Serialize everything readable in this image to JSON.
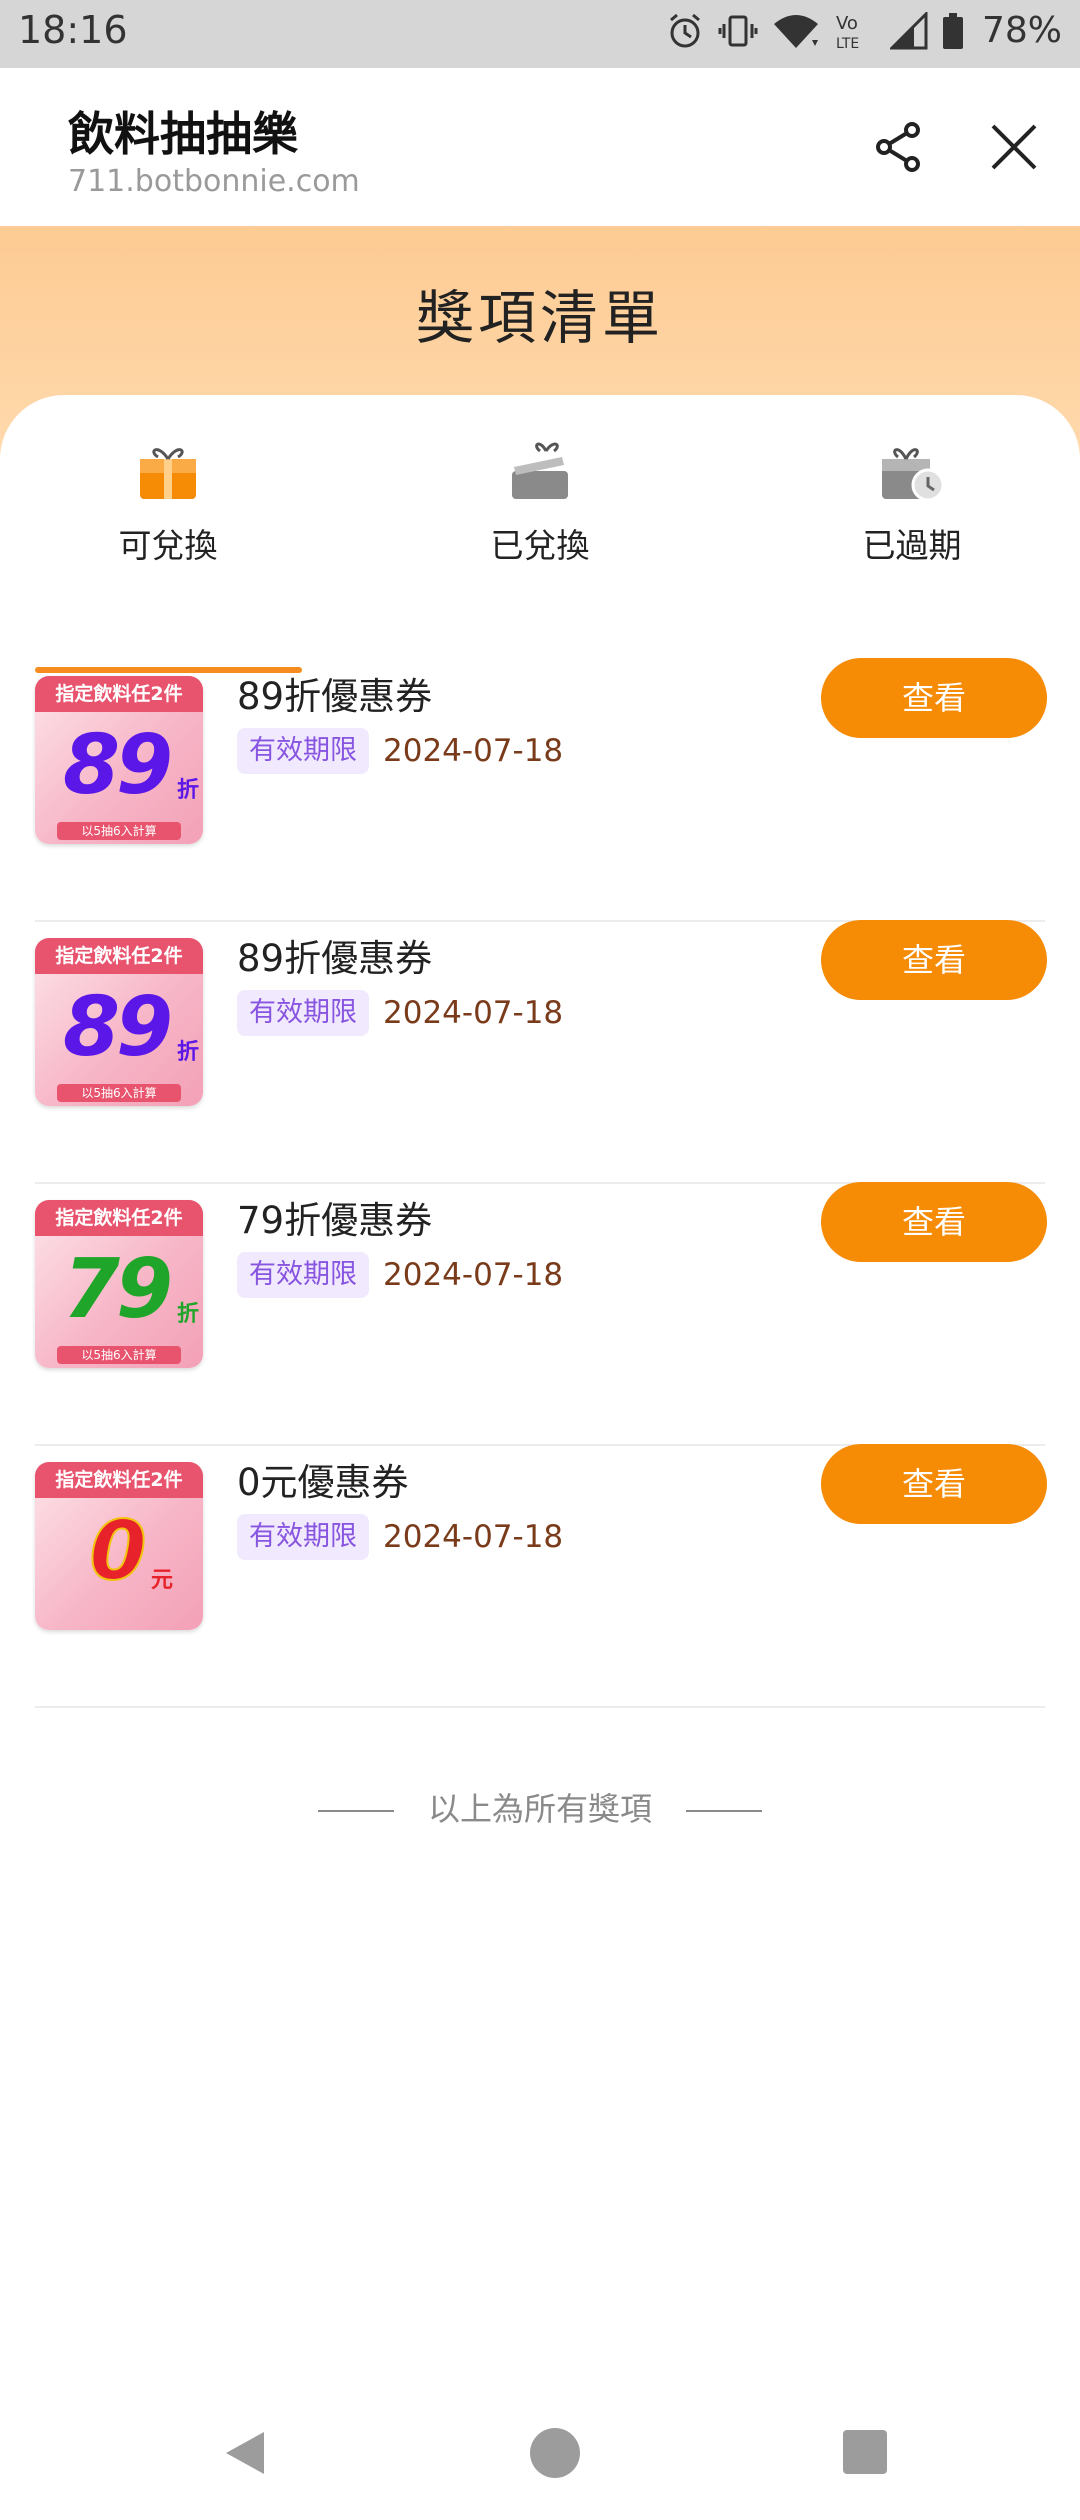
{
  "status_bar": {
    "time": "18:16",
    "battery": "78%",
    "icons": [
      "alarm-icon",
      "vibrate-icon",
      "wifi-icon",
      "volte-icon",
      "signal-icon",
      "battery-icon"
    ]
  },
  "app_bar": {
    "title": "飲料抽抽樂",
    "url": "711.botbonnie.com",
    "icons": [
      "share-icon",
      "close-icon"
    ]
  },
  "banner": {
    "title": "獎項清單"
  },
  "tabs": [
    {
      "label": "可兌換",
      "icon": "gift-box-icon",
      "active": true
    },
    {
      "label": "已兌換",
      "icon": "opened-gift-icon",
      "active": false
    },
    {
      "label": "已過期",
      "icon": "expired-gift-icon",
      "active": false
    }
  ],
  "prizes": [
    {
      "name": "89折優惠券",
      "expiry_label": "有效期限",
      "expiry_date": "2024-07-18",
      "button": "查看",
      "thumb": {
        "band": "指定飲料任2件",
        "value": "89",
        "suffix": "折",
        "note": "以5抽6入計算",
        "color": "#5a17e8"
      }
    },
    {
      "name": "89折優惠券",
      "expiry_label": "有效期限",
      "expiry_date": "2024-07-18",
      "button": "查看",
      "thumb": {
        "band": "指定飲料任2件",
        "value": "89",
        "suffix": "折",
        "note": "以5抽6入計算",
        "color": "#5a17e8"
      }
    },
    {
      "name": "79折優惠券",
      "expiry_label": "有效期限",
      "expiry_date": "2024-07-18",
      "button": "查看",
      "thumb": {
        "band": "指定飲料任2件",
        "value": "79",
        "suffix": "折",
        "note": "以5抽6入計算",
        "color": "#1fa62a"
      }
    },
    {
      "name": "0元優惠券",
      "expiry_label": "有效期限",
      "expiry_date": "2024-07-18",
      "button": "查看",
      "thumb": {
        "band": "指定飲料任2件",
        "value": "0",
        "suffix": "元",
        "note": "",
        "color": "#f1c40f"
      }
    }
  ],
  "footer": {
    "text": "以上為所有獎項"
  },
  "colors": {
    "accent": "#f68b06",
    "banner": "#fdcb93",
    "badge_bg": "#f1eafe",
    "badge_text": "#8855e0"
  }
}
